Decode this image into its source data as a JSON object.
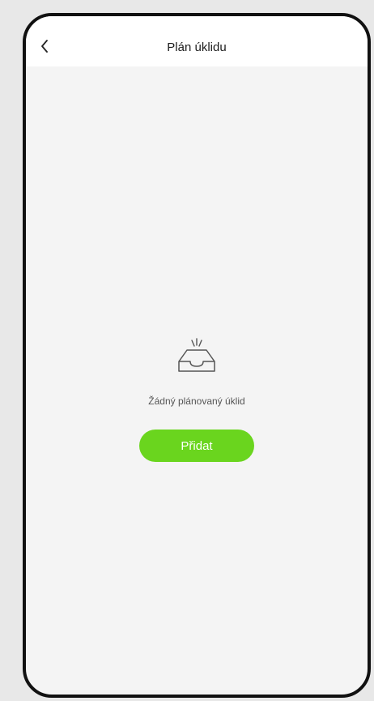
{
  "header": {
    "title": "Plán úklidu",
    "back_icon": "chevron-left-icon"
  },
  "empty_state": {
    "icon": "empty-inbox-icon",
    "message": "Žádný plánovaný úklid",
    "add_button_label": "Přidat"
  },
  "colors": {
    "accent": "#6ad51e",
    "background": "#f4f4f4",
    "header": "#ffffff",
    "frame": "#111111"
  }
}
